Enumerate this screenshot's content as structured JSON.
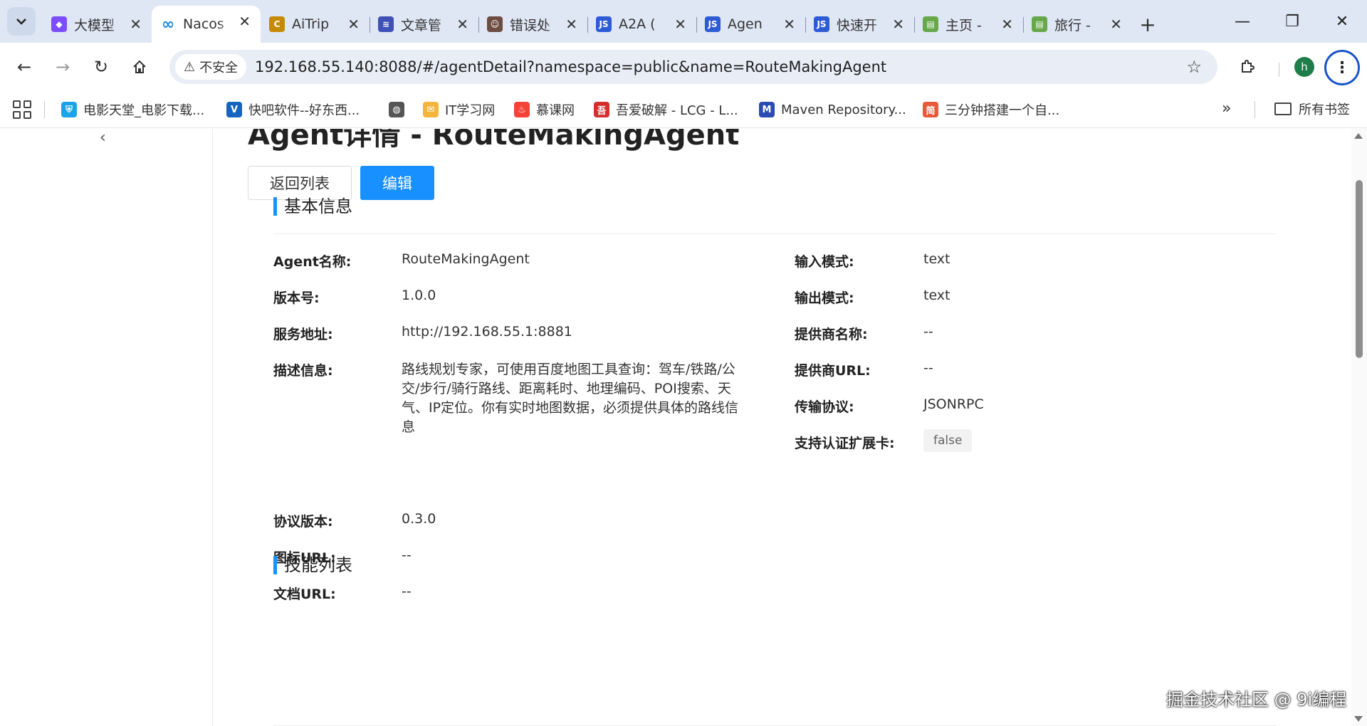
{
  "browser": {
    "tabs": [
      {
        "title": "大模型",
        "icon": "gem-icon",
        "color": "#7b4dff"
      },
      {
        "title": "Nacos",
        "icon": "infinity-icon",
        "color": "#1e88e5",
        "active": true
      },
      {
        "title": "AiTrip",
        "icon": "c-logo-icon",
        "color": "#c58b00"
      },
      {
        "title": "文章管",
        "icon": "layers-icon",
        "color": "#3f51b5"
      },
      {
        "title": "错误处",
        "icon": "person-icon",
        "color": "#6d4c41"
      },
      {
        "title": "A2A (",
        "icon": "js-icon",
        "color": "#2d5bd7"
      },
      {
        "title": "Agen",
        "icon": "js-icon",
        "color": "#2d5bd7"
      },
      {
        "title": "快速开",
        "icon": "js-icon",
        "color": "#2d5bd7"
      },
      {
        "title": "主页 -",
        "icon": "doc-icon",
        "color": "#66a84a"
      },
      {
        "title": "旅行 -",
        "icon": "doc-icon",
        "color": "#66a84a"
      }
    ],
    "security_label": "不安全",
    "url": "192.168.55.140:8088/#/agentDetail?namespace=public&name=RouteMakingAgent",
    "profile_initial": "h",
    "profile_color": "#1e7d4a",
    "bookmarks": [
      {
        "label": "电影天堂_电影下载...",
        "icon": "shield-icon",
        "color": "#1aa3e8"
      },
      {
        "label": "快吧软件--好东西...",
        "icon": "v-icon",
        "color": "#1565c0"
      },
      {
        "label": "",
        "icon": "globe-icon",
        "color": "#555555"
      },
      {
        "label": "IT学习网",
        "icon": "envelope-icon",
        "color": "#f3b53b"
      },
      {
        "label": "慕课网",
        "icon": "flame-icon",
        "color": "#f44336"
      },
      {
        "label": "吾爱破解 - LCG - L...",
        "icon": "seal-icon",
        "color": "#d32f2f"
      },
      {
        "label": "Maven Repository...",
        "icon": "m-icon",
        "color": "#2b4bb3"
      },
      {
        "label": "三分钟搭建一个自...",
        "icon": "jian-icon",
        "color": "#e8583a"
      }
    ],
    "all_bookmarks_label": "所有书签"
  },
  "page": {
    "title": "Agent详情 - RouteMakingAgent",
    "back_button": "返回列表",
    "edit_button": "编辑",
    "basic_info": {
      "heading": "基本信息",
      "left": [
        {
          "label": "Agent名称:",
          "value": "RouteMakingAgent"
        },
        {
          "label": "版本号:",
          "value": "1.0.0"
        },
        {
          "label": "服务地址:",
          "value": "http://192.168.55.1:8881"
        },
        {
          "label": "描述信息:",
          "value": "路线规划专家，可使用百度地图工具查询：驾车/铁路/公交/步行/骑行路线、距离耗时、地理编码、POI搜索、天气、IP定位。你有实时地图数据，必须提供具体的路线信息"
        },
        {
          "label": "协议版本:",
          "value": "0.3.0"
        },
        {
          "label": "图标URL:",
          "value": "--"
        },
        {
          "label": "文档URL:",
          "value": "--"
        }
      ],
      "right": [
        {
          "label": "输入模式:",
          "value": "text"
        },
        {
          "label": "输出模式:",
          "value": "text"
        },
        {
          "label": "提供商名称:",
          "value": "--"
        },
        {
          "label": "提供商URL:",
          "value": "--"
        },
        {
          "label": "传输协议:",
          "value": "JSONRPC"
        },
        {
          "label": "支持认证扩展卡:",
          "value": "false"
        }
      ]
    },
    "skills": {
      "heading": "技能列表"
    },
    "accent_color": "#1890ff"
  },
  "watermark": "掘金技术社区 @ 9i编程"
}
